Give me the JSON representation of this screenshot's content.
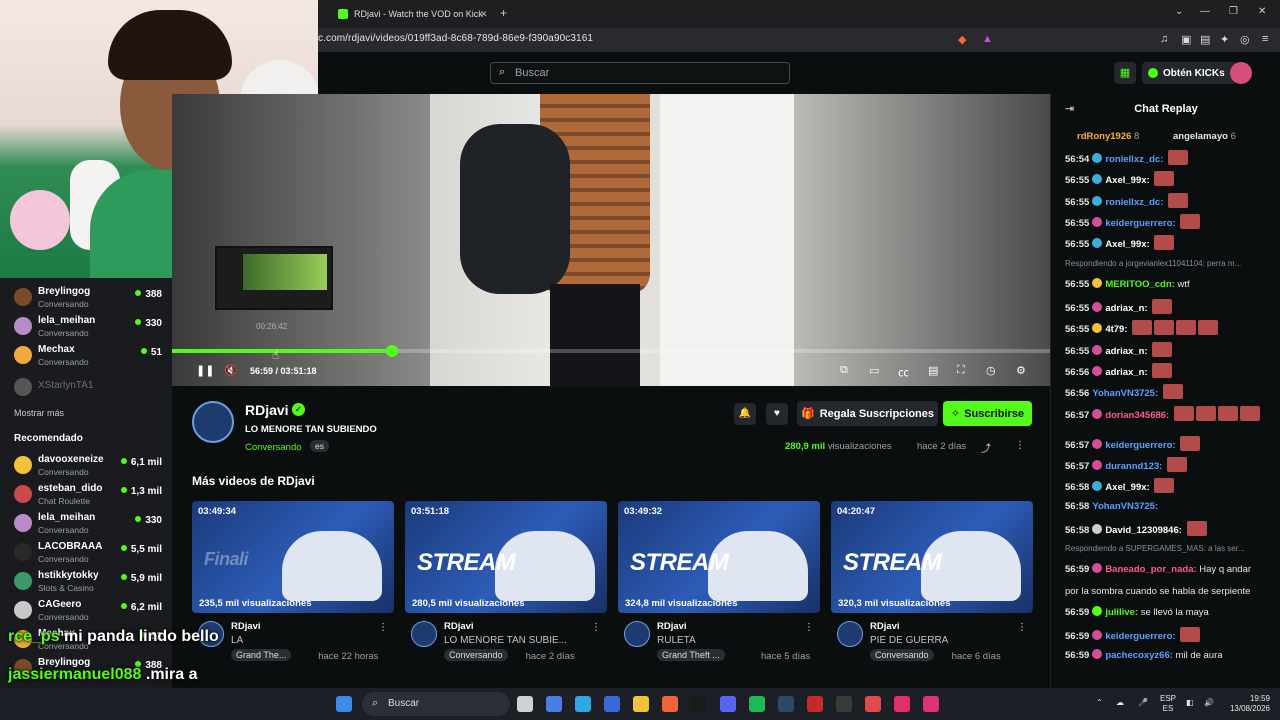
{
  "browser": {
    "tab_title": "RDjavi - Watch the VOD on Kick",
    "tab_close": "✕",
    "new_tab": "+",
    "url": "c.com/rdjavi/videos/019ff3ad-8c68-789d-86e9-f390a90c3161",
    "window_controls": [
      "⌄",
      "—",
      "❐",
      "✕"
    ]
  },
  "kicknav": {
    "search_placeholder": "Buscar",
    "kicks_label": "Obtén KICKs"
  },
  "sidebar": {
    "following": [
      {
        "name": "Breylingog",
        "sub": "Conversando",
        "viewers": "388",
        "color": "#7a4a2a",
        "offline": false
      },
      {
        "name": "lela_meihan",
        "sub": "Conversando",
        "viewers": "330",
        "color": "#b88ac8",
        "offline": false
      },
      {
        "name": "Mechax",
        "sub": "Conversando",
        "viewers": "51",
        "color": "#f2a93b",
        "offline": false
      },
      {
        "name": "XStarlynTA1",
        "sub": "",
        "viewers": "",
        "color": "#555",
        "offline": true
      }
    ],
    "show_more": "Mostrar más",
    "recommended_heading": "Recomendado",
    "recommended": [
      {
        "name": "davooxeneize",
        "sub": "Conversando",
        "viewers": "6,1 mil",
        "color": "#f2c23b"
      },
      {
        "name": "esteban_dido",
        "sub": "Chat Roulette",
        "viewers": "1,3 mil",
        "color": "#c84a4a"
      },
      {
        "name": "lela_meihan",
        "sub": "Conversando",
        "viewers": "330",
        "color": "#b88ac8"
      },
      {
        "name": "LACOBRAAA",
        "sub": "Conversando",
        "viewers": "5,5 mil",
        "color": "#2a2a2a"
      },
      {
        "name": "hstikkytokky",
        "sub": "Slots & Casino",
        "viewers": "5,9 mil",
        "color": "#3a9a6a"
      },
      {
        "name": "CAGeero",
        "sub": "Conversando",
        "viewers": "6,2 mil",
        "color": "#c8c8c8"
      },
      {
        "name": "Mechax",
        "sub": "Conversando",
        "viewers": "51",
        "color": "#f2a93b"
      },
      {
        "name": "Breylingog",
        "sub": "Conversando",
        "viewers": "388",
        "color": "#7a4a2a"
      }
    ]
  },
  "player": {
    "preview_time": "00:26:42",
    "time_label": "56:59 / 03:51:18",
    "progress_fraction": 0.25
  },
  "channel": {
    "name": "RDjavi",
    "verified_mark": "✓",
    "title": "LO MENORE TAN SUBIENDO",
    "category": "Conversando",
    "language": "es",
    "gift_label": "Regala Suscripciones",
    "subscribe_label": "Suscribirse",
    "views_value": "280,9 mil",
    "views_word": "visualizaciones",
    "ago": "hace 2 días"
  },
  "more_videos_heading": "Más videos de RDjavi",
  "videos": [
    {
      "duration": "03:49:34",
      "views": "235,5 mil visualizaciones",
      "channel": "RDjavi",
      "title": "LA",
      "category": "Grand The...",
      "ago": "hace 22 horas",
      "thumb_word": "Finali"
    },
    {
      "duration": "03:51:18",
      "views": "280,5 mil visualizaciones",
      "channel": "RDjavi",
      "title": "LO MENORE TAN SUBIE...",
      "category": "Conversando",
      "ago": "hace 2 días",
      "thumb_word": "STREAM"
    },
    {
      "duration": "03:49:32",
      "views": "324,8 mil visualizaciones",
      "channel": "RDjavi",
      "title": "RULETA",
      "category": "Grand Theft ...",
      "ago": "hace 5 días",
      "thumb_word": "STREAM"
    },
    {
      "duration": "04:20:47",
      "views": "320,3 mil visualizaciones",
      "channel": "RDjavi",
      "title": "PIE DE GUERRA",
      "category": "Conversando",
      "ago": "hace 6 días",
      "thumb_word": "STREAM"
    }
  ],
  "chat": {
    "title": "Chat Replay",
    "pinned": [
      {
        "user": "rdRony1926",
        "count": "8"
      },
      {
        "user": "angelamayo",
        "count": "6"
      }
    ],
    "messages": [
      {
        "time": "56:54",
        "user": "roniellxz_dc:",
        "color": "#5aa2ff",
        "badge": "#3ab0d8",
        "text": "",
        "emotes": 1
      },
      {
        "time": "56:55",
        "user": "Axel_99x:",
        "color": "#ffffff",
        "badge": "#3ab0d8",
        "text": "",
        "emotes": 1
      },
      {
        "time": "56:55",
        "user": "roniellxz_dc:",
        "color": "#5aa2ff",
        "badge": "#3ab0d8",
        "text": "",
        "emotes": 1
      },
      {
        "time": "56:55",
        "user": "keiderguerrero:",
        "color": "#5aa2ff",
        "badge": "#d64d9a",
        "text": "",
        "emotes": 1
      },
      {
        "time": "56:55",
        "user": "Axel_99x:",
        "color": "#ffffff",
        "badge": "#3ab0d8",
        "text": "",
        "emotes": 1
      },
      {
        "time": "",
        "user": "",
        "color": "#8a8f93",
        "badge": "",
        "text": "Respondiendo a jorgevianlex11041104: perra m...",
        "emotes": 0,
        "reply": true
      },
      {
        "time": "56:55",
        "user": "MERITOO_cdn:",
        "color": "#53fc18",
        "badge": "#f2c23b",
        "text": "wtf",
        "emotes": 0
      },
      {
        "time": "56:55",
        "user": "adriax_n:",
        "color": "#ffffff",
        "badge": "#d64d9a",
        "text": "",
        "emotes": 1
      },
      {
        "time": "56:55",
        "user": "4t79:",
        "color": "#ffffff",
        "badge": "#f2c23b",
        "text": "",
        "emotes": 4
      },
      {
        "time": "56:55",
        "user": "adriax_n:",
        "color": "#ffffff",
        "badge": "#d64d9a",
        "text": "",
        "emotes": 1
      },
      {
        "time": "56:56",
        "user": "adriax_n:",
        "color": "#ffffff",
        "badge": "#d64d9a",
        "text": "",
        "emotes": 1
      },
      {
        "time": "56:56",
        "user": "YohanVN3725:",
        "color": "#5aa2ff",
        "badge": "",
        "text": "",
        "emotes": 1
      },
      {
        "time": "56:57",
        "user": "dorian345686:",
        "color": "#ff5a8a",
        "badge": "#d64d9a",
        "text": "",
        "emotes": 4
      },
      {
        "time": "56:57",
        "user": "keiderguerrero:",
        "color": "#5aa2ff",
        "badge": "#d64d9a",
        "text": "",
        "emotes": 1
      },
      {
        "time": "56:57",
        "user": "durannd123:",
        "color": "#5aa2ff",
        "badge": "#d64d9a",
        "text": "",
        "emotes": 1
      },
      {
        "time": "56:58",
        "user": "Axel_99x:",
        "color": "#ffffff",
        "badge": "#3ab0d8",
        "text": "",
        "emotes": 1
      },
      {
        "time": "56:58",
        "user": "YohanVN3725:",
        "color": "#5aa2ff",
        "badge": "",
        "text": "",
        "emotes": 0
      },
      {
        "time": "56:58",
        "user": "David_12309846:",
        "color": "#ffffff",
        "badge": "#cfcfcf",
        "text": "",
        "emotes": 1
      },
      {
        "time": "",
        "user": "",
        "color": "#8a8f93",
        "badge": "",
        "text": "Respondiendo a SUPERGAMES_MAS: a las ser...",
        "emotes": 0,
        "reply": true
      },
      {
        "time": "56:59",
        "user": "Baneado_por_nada:",
        "color": "#ff5a8a",
        "badge": "#d64d9a",
        "text": "Hay q andar",
        "emotes": 0
      },
      {
        "time": "",
        "user": "",
        "color": "#e6e6e6",
        "badge": "",
        "text": "por la sombra cuando se habla de serpiente",
        "emotes": 0,
        "cont": true
      },
      {
        "time": "56:59",
        "user": "julilive:",
        "color": "#53fc18",
        "badge": "#53fc18",
        "text": "se llevó la maya",
        "emotes": 0
      },
      {
        "time": "56:59",
        "user": "keiderguerrero:",
        "color": "#5aa2ff",
        "badge": "#d64d9a",
        "text": "",
        "emotes": 1
      },
      {
        "time": "56:59",
        "user": "pachecoxyz66:",
        "color": "#5aa2ff",
        "badge": "#d64d9a",
        "text": "mil de aura",
        "emotes": 0
      }
    ]
  },
  "overlay": {
    "line1_user": "rce_ps",
    "line1_text": "mi panda lindo bello",
    "line2_user": "jassiermanuel088",
    "line2_text": ".mira a"
  },
  "taskbar": {
    "search": "Buscar",
    "lang_top": "ESP",
    "lang_bottom": "ES",
    "time": "19:59",
    "date": "13/08/2026"
  }
}
